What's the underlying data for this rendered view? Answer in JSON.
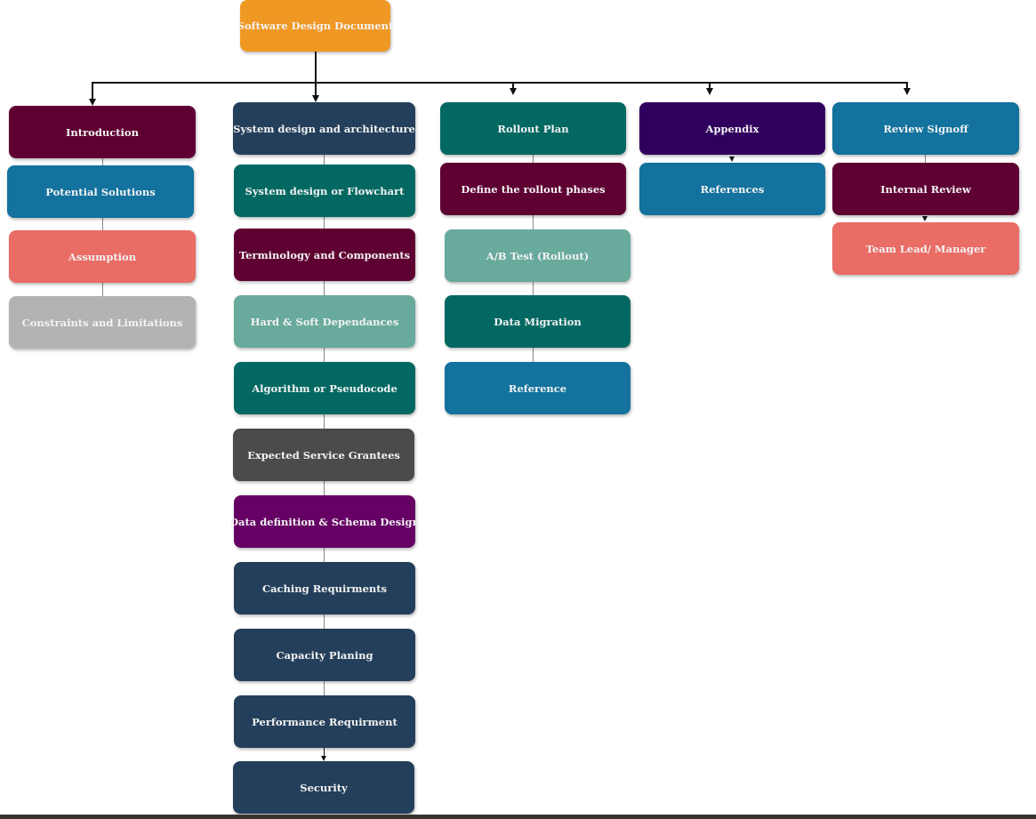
{
  "diagram": {
    "root": {
      "label": "Software Design Document",
      "color": "#f09824"
    },
    "columns": [
      {
        "name": "introduction-column",
        "nodes": [
          {
            "label": "Introduction",
            "color": "#5f0032"
          },
          {
            "label": "Potential Solutions",
            "color": "#13729e"
          },
          {
            "label": "Assumption",
            "color": "#e96c65"
          },
          {
            "label": "Constraints and Limitations",
            "color": "#b3b3b3"
          }
        ]
      },
      {
        "name": "system-design-column",
        "nodes": [
          {
            "label": "System design and architecture",
            "color": "#243f5b"
          },
          {
            "label": "System design or Flowchart",
            "color": "#036862"
          },
          {
            "label": "Terminology and Components",
            "color": "#5f0032"
          },
          {
            "label": "Hard & Soft Dependances",
            "color": "#68aa9c"
          },
          {
            "label": "Algorithm or Pseudocode",
            "color": "#036862"
          },
          {
            "label": "Expected Service  Grantees",
            "color": "#4b4b4b"
          },
          {
            "label": "Data definition & Schema Design",
            "color": "#660064"
          },
          {
            "label": "Caching Requirments",
            "color": "#243f5b"
          },
          {
            "label": "Capacity Planing",
            "color": "#243f5b"
          },
          {
            "label": "Performance Requirment",
            "color": "#243f5b"
          },
          {
            "label": "Security",
            "color": "#243f5b"
          }
        ]
      },
      {
        "name": "rollout-column",
        "nodes": [
          {
            "label": "Rollout  Plan",
            "color": "#036862"
          },
          {
            "label": "Define the rollout phases",
            "color": "#5f0032"
          },
          {
            "label": "A/B Test (Rollout)",
            "color": "#68aa9c"
          },
          {
            "label": "Data Migration",
            "color": "#036862"
          },
          {
            "label": "Reference",
            "color": "#13729e"
          }
        ]
      },
      {
        "name": "appendix-column",
        "nodes": [
          {
            "label": "Appendix",
            "color": "#30005e"
          },
          {
            "label": "References",
            "color": "#13729e"
          }
        ]
      },
      {
        "name": "review-column",
        "nodes": [
          {
            "label": "Review Signoff",
            "color": "#13729e"
          },
          {
            "label": "Internal Review",
            "color": "#5f0032"
          },
          {
            "label": "Team Lead/ Manager",
            "color": "#e96c65"
          }
        ]
      }
    ]
  }
}
